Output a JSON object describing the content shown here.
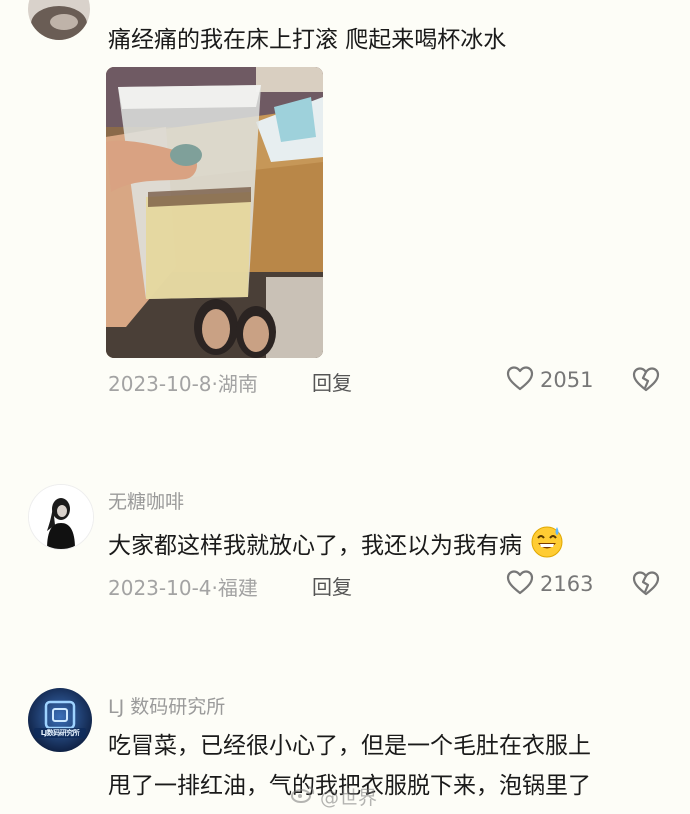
{
  "comments": [
    {
      "text": "痛经痛的我在床上打滚  爬起来喝杯冰水",
      "date": "2023-10-8",
      "location": "湖南",
      "reply_label": "回复",
      "likes": "2051"
    },
    {
      "username": "无糖咖啡",
      "text": "大家都这样我就放心了，我还以为我有病",
      "emoji": "grinning-sweat-emoji",
      "date": "2023-10-4",
      "location": "福建",
      "reply_label": "回复",
      "likes": "2163"
    },
    {
      "username": "LJ 数码研究所",
      "avatar_text": "LJ数码研究所",
      "text_line1": "吃冒菜，已经很小心了，但是一个毛肚在衣服上",
      "text_line2": "甩了一排红油，气的我把衣服脱下来，泡锅里了"
    }
  ],
  "meta_separator": "·",
  "watermark": "@世界"
}
